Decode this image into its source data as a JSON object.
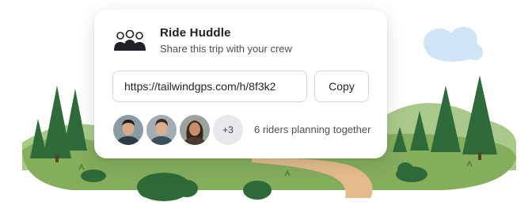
{
  "share_card": {
    "title": "Ride Huddle",
    "subtitle": "Share this trip with your crew",
    "link_value": "https://tailwindgps.com/h/8f3k2",
    "copy_label": "Copy",
    "extra_riders_badge": "+3",
    "riders_summary": "6 riders planning together",
    "icon": "group-of-people-icon"
  },
  "avatars": [
    {
      "name": "rider-avatar-1"
    },
    {
      "name": "rider-avatar-2"
    },
    {
      "name": "rider-avatar-3"
    }
  ],
  "colors": {
    "sky": "#cde6f7",
    "hills": "#7ea65a",
    "trees": "#2f6b3a",
    "path": "#e3b98a"
  }
}
